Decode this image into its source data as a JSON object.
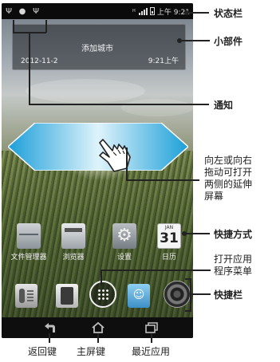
{
  "status_bar": {
    "network_type": "H",
    "time": "上午 9:21"
  },
  "widget": {
    "add_city": "添加城市",
    "date": "2012-11-2",
    "time": "9:21上午"
  },
  "shortcuts": [
    {
      "label": "文件管理器",
      "icon": "file-manager-icon"
    },
    {
      "label": "浏览器",
      "icon": "browser-icon"
    },
    {
      "label": "设置",
      "icon": "gear-icon"
    },
    {
      "label": "日历",
      "icon": "calendar-icon",
      "month": "JAN",
      "day": "31"
    }
  ],
  "dock": [
    {
      "icon": "phone-dialer-icon"
    },
    {
      "icon": "contacts-icon"
    },
    {
      "icon": "app-drawer-icon"
    },
    {
      "icon": "messages-icon"
    },
    {
      "icon": "camera-icon"
    }
  ],
  "navbar": [
    {
      "icon": "back-icon"
    },
    {
      "icon": "home-icon"
    },
    {
      "icon": "recent-apps-icon"
    }
  ],
  "callouts": {
    "status_bar": "状态栏",
    "widget": "小部件",
    "notification": "通知",
    "swipe_hint": [
      "向左或向右",
      "拖动可打开",
      "两侧的延伸",
      "屏幕"
    ],
    "shortcuts": "快捷方式",
    "app_menu": [
      "打开应用",
      "程序菜单"
    ],
    "dock": "快捷栏",
    "back_key": "返回键",
    "home_key": "主屏键",
    "recent_key": "最近应用"
  }
}
